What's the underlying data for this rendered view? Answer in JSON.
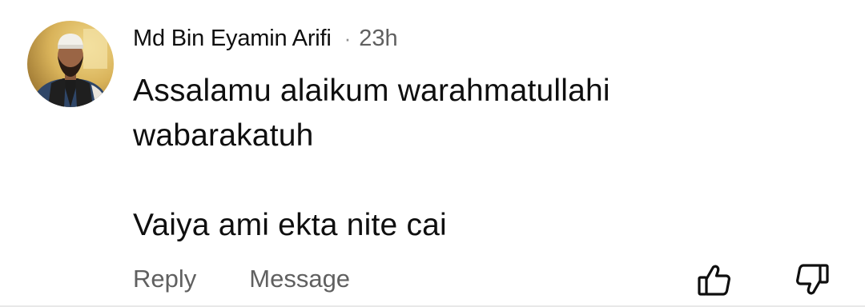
{
  "comment": {
    "author": "Md Bin Eyamin Arifi",
    "separator": "·",
    "timestamp": "23h",
    "text_lines": [
      "Assalamu alaikum warahmatullahi",
      "wabarakatuh",
      "",
      "Vaiya ami ekta nite cai"
    ]
  },
  "actions": {
    "reply_label": "Reply",
    "message_label": "Message"
  },
  "icons": {
    "like": "thumbs-up-icon",
    "dislike": "thumbs-down-icon"
  },
  "colors": {
    "text_primary": "#0f0f0f",
    "text_secondary": "#606060",
    "background": "#ffffff"
  }
}
